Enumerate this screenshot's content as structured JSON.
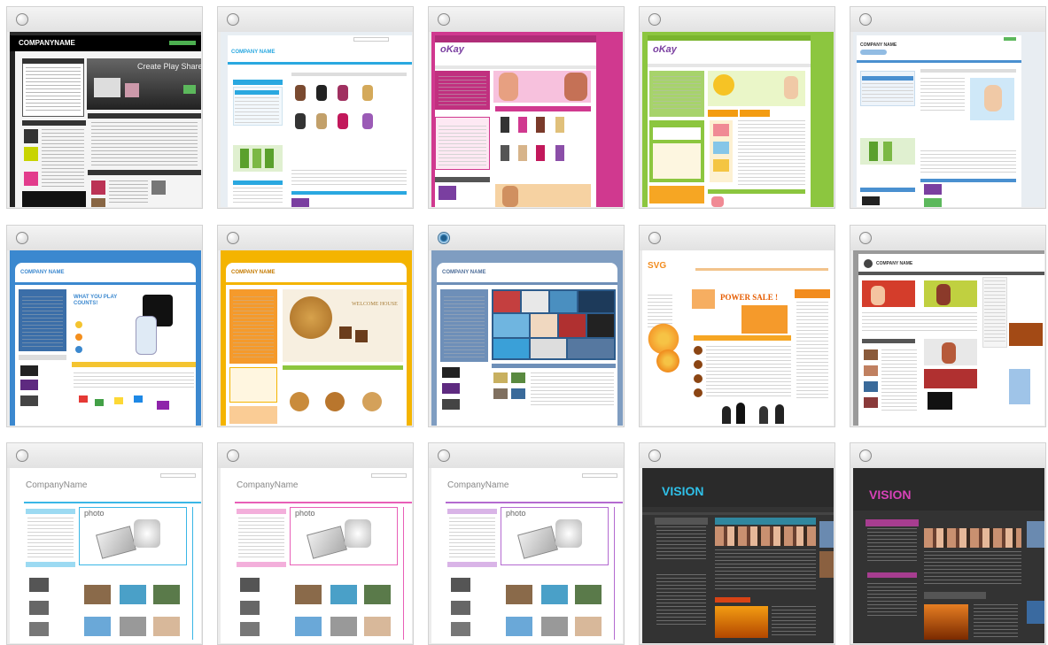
{
  "gallery": {
    "selected_index": 7,
    "templates": [
      {
        "name": "template-1",
        "header_text": "COMPANYNAME",
        "hero_text": "Create  Play  Share",
        "accent": "#000000"
      },
      {
        "name": "template-2",
        "header_text": "COMPANY NAME",
        "hero_text": "",
        "accent": "#2aa8e0"
      },
      {
        "name": "template-3",
        "header_text": "oKay",
        "hero_text": "",
        "accent": "#d0398f"
      },
      {
        "name": "template-4",
        "header_text": "oKay",
        "hero_text": "",
        "accent": "#8cc63f"
      },
      {
        "name": "template-5",
        "header_text": "COMPANY NAME",
        "hero_text": "",
        "accent": "#4a90d0"
      },
      {
        "name": "template-6",
        "header_text": "COMPANY NAME",
        "hero_text": "WHAT YOU PLAY COUNTS!",
        "accent": "#3b88cf"
      },
      {
        "name": "template-7",
        "header_text": "COMPANY NAME",
        "hero_text": "WELCOME HOUSE",
        "accent": "#f4b400"
      },
      {
        "name": "template-8",
        "header_text": "COMPANY NAME",
        "hero_text": "",
        "accent": "#6e8fb8"
      },
      {
        "name": "template-9",
        "header_text": "SVG",
        "hero_text": "POWER SALE !",
        "accent": "#f28c1e"
      },
      {
        "name": "template-10",
        "header_text": "COMPANY NAME",
        "hero_text": "",
        "accent": "#8a8a8a"
      },
      {
        "name": "template-11",
        "header_text": "CompanyName",
        "hero_text": "photo",
        "accent": "#39b6e6"
      },
      {
        "name": "template-12",
        "header_text": "CompanyName",
        "hero_text": "photo",
        "accent": "#e85fb7"
      },
      {
        "name": "template-13",
        "header_text": "CompanyName",
        "hero_text": "photo",
        "accent": "#b46ad0"
      },
      {
        "name": "template-14",
        "header_text": "VISION",
        "hero_text": "",
        "accent": "#2fc0e8"
      },
      {
        "name": "template-15",
        "header_text": "VISION",
        "hero_text": "",
        "accent": "#d842b8"
      }
    ]
  }
}
